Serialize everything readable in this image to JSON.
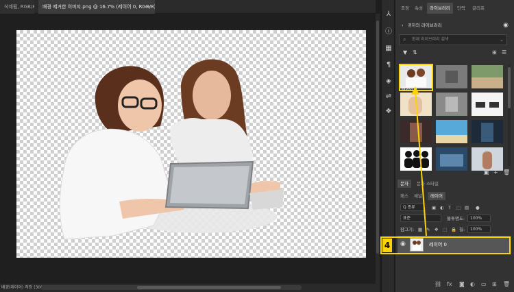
{
  "tabs": [
    {
      "label": "삭제됨, RGB/8)"
    },
    {
      "label": "배경 제거한 이미지.png @ 16.7% (레이어 0, RGB/8)",
      "close": "×"
    }
  ],
  "status": {
    "text": "배경(레이어) 저장 (300 ppi)"
  },
  "panel_tabs": [
    "조정",
    "속성",
    "라이브러리",
    "단락",
    "글리프"
  ],
  "library": {
    "title": "귀하의 라이브러리",
    "search_placeholder": "현재 라이브러리 검색",
    "selected_label": "레이어 0"
  },
  "bottom_tabs": [
    "문자",
    "문자 스타일"
  ],
  "layer_tabs": [
    "패스",
    "채널",
    "레이어"
  ],
  "layers_controls": {
    "kind": "Q 종류",
    "blend_mode": "표준",
    "opacity_label": "불투명도:",
    "opacity_value": "100%",
    "lock_label": "잠그기:",
    "fill_label": "칠:",
    "fill_value": "100%"
  },
  "layer": {
    "name": "레이어 0"
  },
  "annotation": {
    "step": "4"
  },
  "colors": {
    "highlight": "#ffd400",
    "panel": "#323232",
    "canvas_bg": "#1f1f1f"
  },
  "icons": [
    "eye-icon",
    "search-icon",
    "chevron-down-icon",
    "fx-icon",
    "folder-icon",
    "trash-icon",
    "add-layer-icon",
    "mask-icon",
    "adjustment-icon",
    "link-icon",
    "grid-view-icon",
    "list-view-icon",
    "user-icon"
  ]
}
